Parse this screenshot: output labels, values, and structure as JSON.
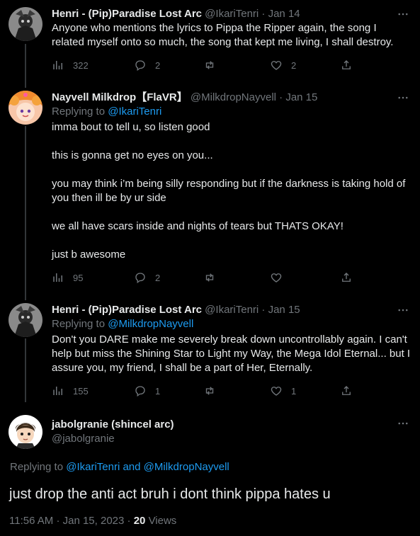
{
  "tweets": [
    {
      "name": "Henri - (Pip)Paradise Lost Arc",
      "handle": "@IkariTenri",
      "date": "Jan 14",
      "text": [
        "Anyone who mentions the lyrics to Pippa the Ripper again, the song I related myself onto so much, the song that kept me living, I shall destroy."
      ],
      "views": "322",
      "replies": "2",
      "retweets": "",
      "likes": "2"
    },
    {
      "name": "Nayvell Milkdrop【FlaVR】",
      "handle": "@MilkdropNayvell",
      "date": "Jan 15",
      "replying_prefix": "Replying to",
      "replying_to": "@IkariTenri",
      "text": [
        "imma bout to tell u, so listen good",
        "this is gonna get no eyes on you...",
        "you may think i’m being silly responding but if the darkness is taking hold of you then ill be by ur side",
        "we all have scars inside and nights of tears but THATS OKAY!",
        "just b awesome"
      ],
      "views": "95",
      "replies": "2",
      "retweets": "",
      "likes": ""
    },
    {
      "name": "Henri - (Pip)Paradise Lost Arc",
      "handle": "@IkariTenri",
      "date": "Jan 15",
      "replying_prefix": "Replying to",
      "replying_to": "@MilkdropNayvell",
      "text": [
        "Don't you DARE make me severely break down uncontrollably again. I can't help but miss the Shining Star to Light my Way, the Mega Idol Eternal... but I assure you, my friend, I shall be a part of Her, Eternally."
      ],
      "views": "155",
      "replies": "1",
      "retweets": "",
      "likes": "1"
    }
  ],
  "main": {
    "name": "jabolgranie (shincel arc)",
    "handle": "@jabolgranie",
    "replying_prefix": "Replying to",
    "replying_to_1": "@IkariTenri",
    "replying_and": "and",
    "replying_to_2": "@MilkdropNayvell",
    "text": "just drop the anti act bruh i dont think pippa hates u",
    "time": "11:56 AM",
    "date": "Jan 15, 2023",
    "views_count": "20",
    "views_label": "Views"
  },
  "separator": "·",
  "icons": [
    "views-icon",
    "reply-icon",
    "retweet-icon",
    "like-icon",
    "share-icon",
    "more-icon"
  ],
  "colors": {
    "background": "#000000",
    "text": "#e7e9ea",
    "muted": "#71767b",
    "link": "#1d9bf0",
    "thread_line": "#333639"
  }
}
